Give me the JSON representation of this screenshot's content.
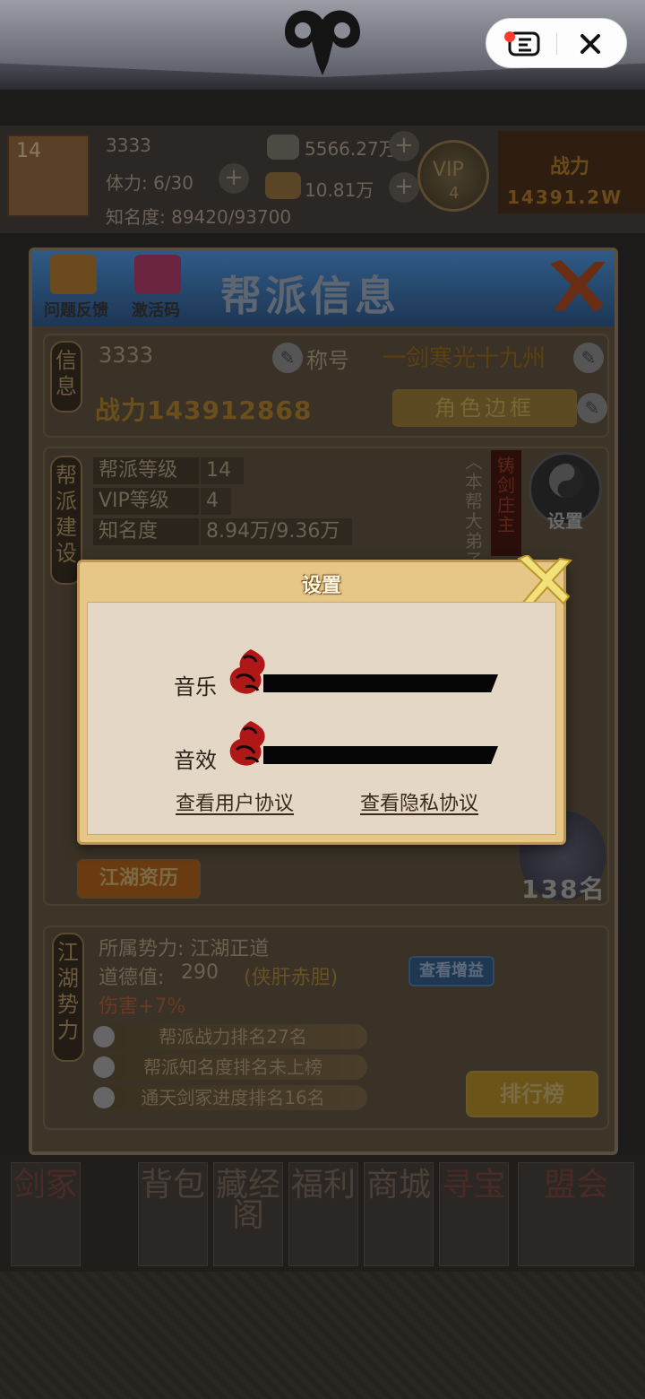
{
  "capsule": {
    "menu_icon": "menu-icon",
    "close_icon": "close-icon"
  },
  "hud": {
    "level": "14",
    "name": "3333",
    "stamina": "体力: 6/30",
    "fame": "知名度: 89420/93700",
    "silver": "5566.27万",
    "gold": "10.81万",
    "vip_label": "VIP",
    "vip_level": "4",
    "power_label": "战力",
    "power_value": "14391.2W"
  },
  "panel": {
    "title": "帮派信息",
    "feedback_label": "问题反馈",
    "gift_label": "激活码",
    "info": {
      "tag": "信息",
      "name": "3333",
      "power": "战力143912868",
      "title_label": "称号",
      "title_value": "一剑寒光十九州",
      "frame_label": "角色边框"
    },
    "build": {
      "tag": "帮派建设",
      "stats": [
        {
          "key": "帮派等级",
          "value": "14"
        },
        {
          "key": "VIP等级",
          "value": "4"
        },
        {
          "key": "知名度",
          "value": "8.94万/9.36万"
        }
      ],
      "role_tag": "铸剑庄主",
      "role_desc": "︿本帮大弟子",
      "settings_label": "设置",
      "jianghu_label": "江湖资历",
      "rank_text": "138名"
    },
    "force": {
      "tag": "江湖势力",
      "faction": "所属势力: 江湖正道",
      "morality_label": "道德值:",
      "morality_value": "290",
      "morality_title": "(侠肝赤胆)",
      "damage": "伤害+7%",
      "view_gain": "查看增益",
      "ranks": [
        "帮派战力排名27名",
        "帮派知名度排名未上榜",
        "通天剑冢进度排名16名"
      ],
      "leaderboard": "排行榜"
    }
  },
  "nav": [
    "剑冢",
    "背包",
    "藏经阁",
    "福利",
    "商城",
    "寻宝",
    "盟会"
  ],
  "dialog": {
    "title": "设置",
    "music_label": "音乐",
    "sfx_label": "音效",
    "music_level": 0,
    "sfx_level": 0,
    "user_agreement": "查看用户协议",
    "privacy_policy": "查看隐私协议"
  }
}
